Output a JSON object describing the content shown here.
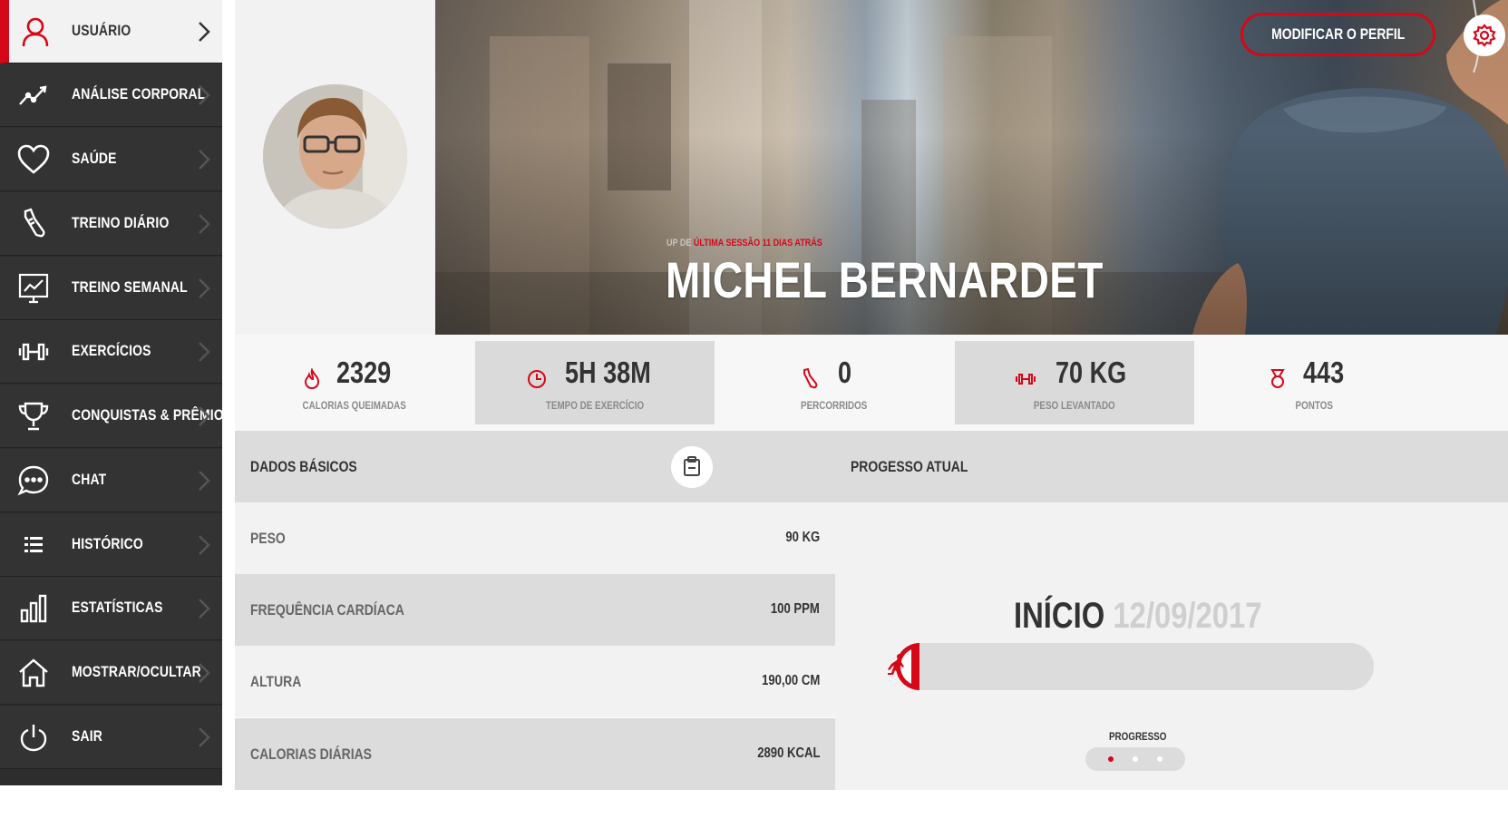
{
  "sidebar": {
    "items": [
      {
        "label": "USUÁRIO",
        "icon": "user-icon"
      },
      {
        "label": "ANÁLISE CORPORAL",
        "icon": "trend-icon"
      },
      {
        "label": "SAÚDE",
        "icon": "heart-icon"
      },
      {
        "label": "TREINO DIÁRIO",
        "icon": "shoe-icon"
      },
      {
        "label": "TREINO SEMANAL",
        "icon": "board-icon"
      },
      {
        "label": "EXERCÍCIOS",
        "icon": "dumbbell-icon"
      },
      {
        "label": "CONQUISTAS & PRÊMIOS",
        "icon": "trophy-icon"
      },
      {
        "label": "CHAT",
        "icon": "chat-icon"
      },
      {
        "label": "HISTÓRICO",
        "icon": "list-icon"
      },
      {
        "label": "ESTATÍSTICAS",
        "icon": "bar-chart-icon"
      },
      {
        "label": "MOSTRAR/OCULTAR",
        "icon": "home-icon"
      },
      {
        "label": "SAIR",
        "icon": "power-icon"
      }
    ],
    "active_index": 0
  },
  "header": {
    "session_prefix": "UP DE",
    "session_text": "ÚLTIMA SESSÃO 11 DIAS ATRÁS",
    "name": "MICHEL BERNARDET",
    "modify_label": "MODIFICAR O PERFIL"
  },
  "stats": [
    {
      "value": "2329",
      "label": "CALORIAS QUEIMADAS",
      "icon": "flame-icon"
    },
    {
      "value": "5H 38M",
      "label": "TEMPO DE EXERCÍCIO",
      "icon": "clock-icon"
    },
    {
      "value": "0",
      "label": "PERCORRIDOS",
      "icon": "shoe-icon"
    },
    {
      "value": "70 KG",
      "label": "PESO LEVANTADO",
      "icon": "dumbbell-icon"
    },
    {
      "value": "443",
      "label": "PONTOS",
      "icon": "medal-icon"
    }
  ],
  "basic": {
    "title": "DADOS BÁSICOS",
    "rows": [
      {
        "label": "PESO",
        "value": "90 KG"
      },
      {
        "label": "FREQUÊNCIA CARDÍACA",
        "value": "100 PPM"
      },
      {
        "label": "ALTURA",
        "value": "190,00 CM"
      },
      {
        "label": "CALORIAS DIÁRIAS",
        "value": "2890 KCAL"
      }
    ]
  },
  "progress": {
    "title": "PROGESSO ATUAL",
    "start_word": "INÍCIO",
    "start_date": "12/09/2017",
    "label": "PROGRESSO",
    "fraction": 0.0,
    "active_slide": 0,
    "slides": 3
  },
  "colors": {
    "accent": "#d5081a",
    "sidebar": "#333333",
    "panel": "#f2f2f2"
  }
}
